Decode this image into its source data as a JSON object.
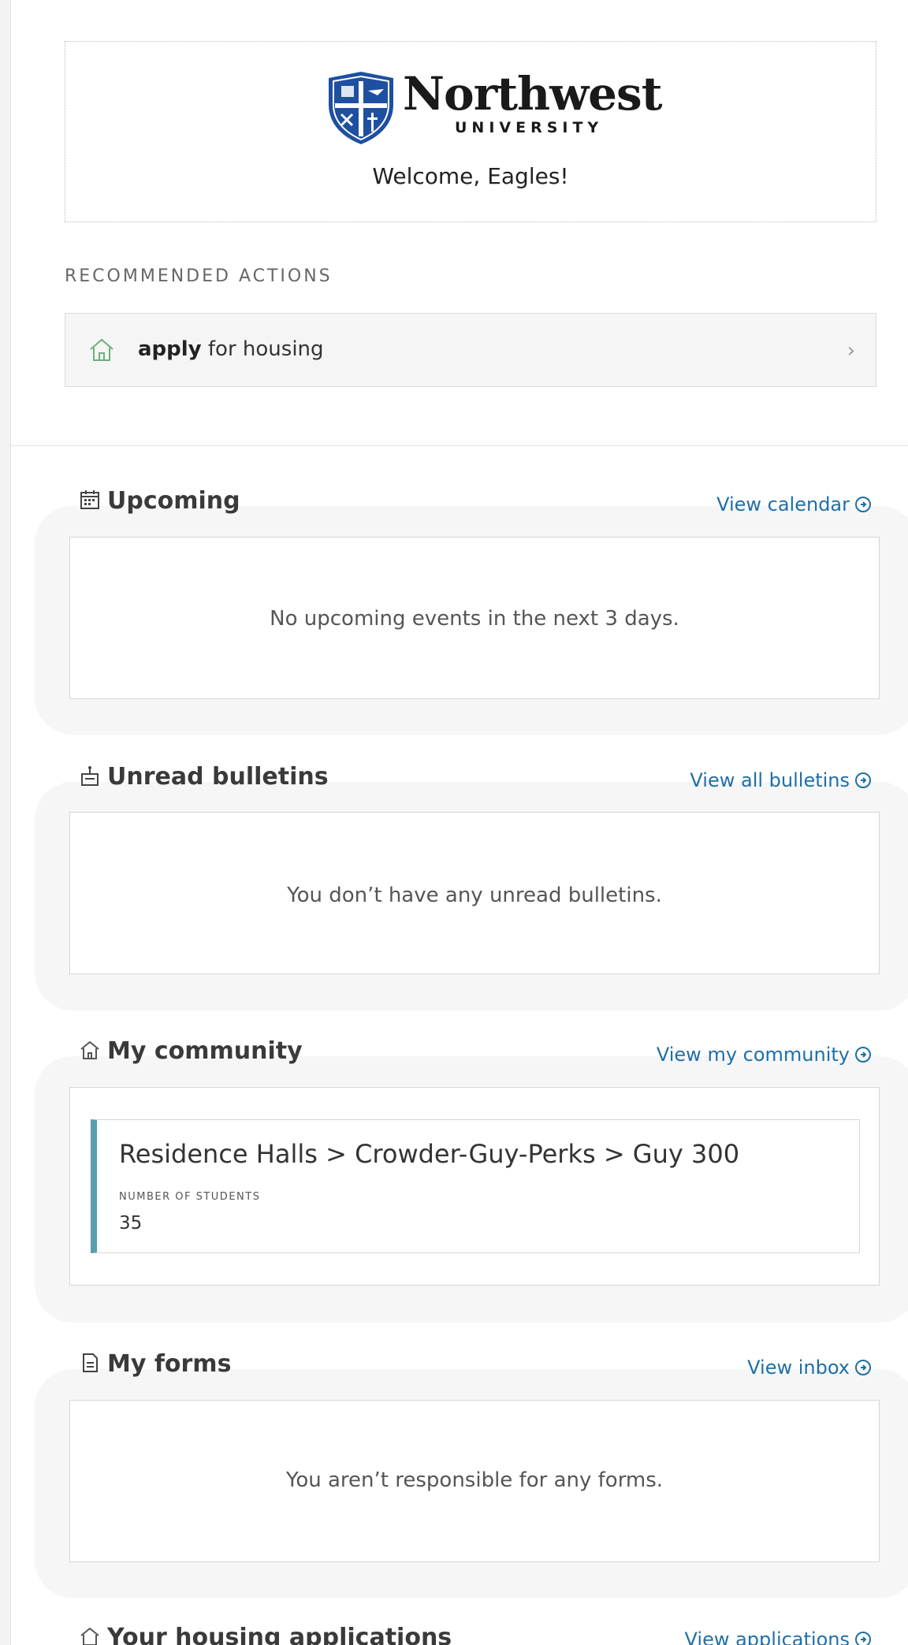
{
  "header": {
    "logo_word": "Northwest",
    "logo_sub": "UNIVERSITY",
    "welcome": "Welcome, Eagles!"
  },
  "recommended": {
    "title": "RECOMMENDED ACTIONS",
    "items": [
      {
        "bold": "apply",
        "text": " for housing",
        "icon": "home-icon"
      }
    ]
  },
  "widgets": {
    "upcoming": {
      "title": "Upcoming",
      "link": "View calendar",
      "empty": "No upcoming events in the next 3 days.",
      "icon": "calendar-icon"
    },
    "bulletins": {
      "title": "Unread bulletins",
      "link": "View all bulletins",
      "empty": "You don’t have any unread bulletins.",
      "icon": "bulletin-icon"
    },
    "community": {
      "title": "My community",
      "link": "View my community",
      "icon": "home-icon",
      "path": "Residence Halls > Crowder-Guy-Perks > Guy 300",
      "count_label": "NUMBER OF STUDENTS",
      "count": "35"
    },
    "forms": {
      "title": "My forms",
      "link": "View inbox",
      "empty": "You aren’t responsible for any forms.",
      "icon": "form-icon"
    },
    "applications": {
      "title": "Your housing applications",
      "link": "View applications",
      "icon": "home-icon"
    }
  },
  "colors": {
    "link": "#1f6fa8",
    "accent_bar": "#5a9fae",
    "logo_blue": "#1e4fa1",
    "home_icon": "#6cb07a"
  }
}
